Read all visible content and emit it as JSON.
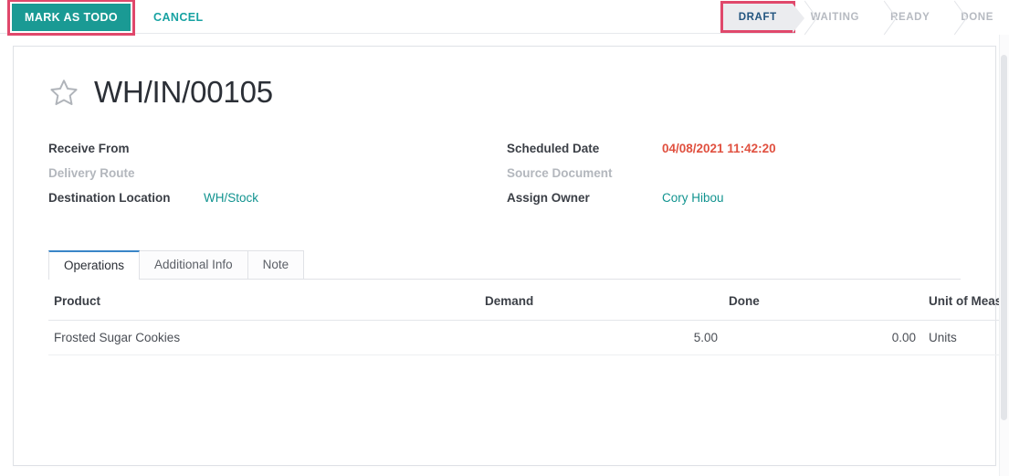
{
  "control_panel": {
    "primary_button": "MARK AS TODO",
    "cancel_button": "CANCEL",
    "highlight_color": "#e0486b",
    "primary_color": "#1a9a94"
  },
  "statusbar": {
    "steps": [
      {
        "label": "DRAFT",
        "state": "active"
      },
      {
        "label": "WAITING",
        "state": "inactive"
      },
      {
        "label": "READY",
        "state": "inactive"
      },
      {
        "label": "DONE",
        "state": "inactive"
      }
    ]
  },
  "record": {
    "title": "WH/IN/00105",
    "favorite_icon": "star-outline-icon"
  },
  "fields": {
    "left": [
      {
        "label": "Receive From",
        "value": "",
        "style": "bold"
      },
      {
        "label": "Delivery Route",
        "value": "",
        "style": "muted"
      },
      {
        "label": "Destination Location",
        "value": "WH/Stock",
        "style": "link"
      }
    ],
    "right": [
      {
        "label": "Scheduled Date",
        "value": "04/08/2021 11:42:20",
        "style": "danger"
      },
      {
        "label": "Source Document",
        "value": "",
        "style": "muted"
      },
      {
        "label": "Assign Owner",
        "value": "Cory Hibou",
        "style": "link"
      }
    ]
  },
  "tabs": [
    {
      "label": "Operations",
      "active": true
    },
    {
      "label": "Additional Info",
      "active": false
    },
    {
      "label": "Note",
      "active": false
    }
  ],
  "table": {
    "columns": [
      "Product",
      "Demand",
      "Done",
      "Unit of Measure"
    ],
    "options_icon": "kebab-menu-icon",
    "rows": [
      {
        "product": "Frosted Sugar Cookies",
        "demand": "5.00",
        "done": "0.00",
        "uom": "Units"
      }
    ]
  }
}
